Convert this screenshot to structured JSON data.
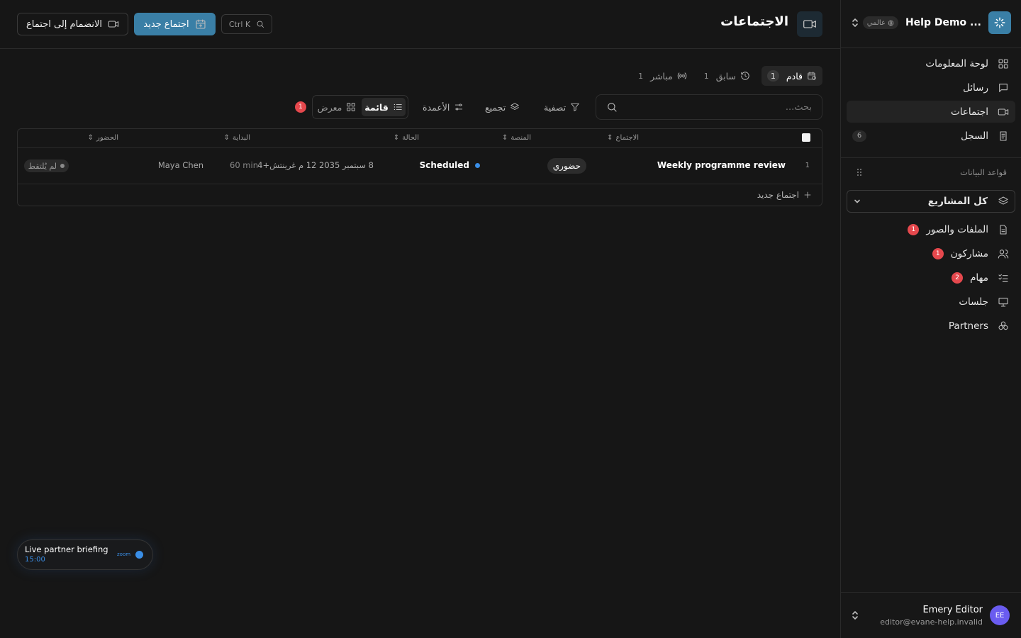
{
  "workspace": {
    "name": "Help Demo ...",
    "badge": "عالمي"
  },
  "sidebar": {
    "nav": [
      {
        "label": "لوحة المعلومات",
        "icon": "dashboard-icon"
      },
      {
        "label": "رسائل",
        "icon": "message-icon"
      },
      {
        "label": "اجتماعات",
        "icon": "video-icon",
        "active": true
      },
      {
        "label": "السجل",
        "icon": "log-icon",
        "count": "6"
      }
    ],
    "section_label": "قواعد البيانات",
    "project_select": "كل المشاريع",
    "db_items": [
      {
        "label": "الملفات والصور",
        "icon": "file-icon",
        "badge": "1"
      },
      {
        "label": "مشاركون",
        "icon": "users-icon",
        "badge": "1"
      },
      {
        "label": "مهام",
        "icon": "tasks-icon",
        "badge": "2"
      },
      {
        "label": "جلسات",
        "icon": "presentation-icon"
      },
      {
        "label": "Partners",
        "icon": "partners-icon"
      }
    ]
  },
  "user": {
    "initials": "EE",
    "name": "Emery Editor",
    "email": "editor@evane-help.invalid"
  },
  "header": {
    "title": "الاجتماعات",
    "new_meeting": "اجتماع جديد",
    "join_meeting": "الانضمام إلى اجتماع",
    "command": "Ctrl K"
  },
  "tabs": [
    {
      "label": "قادم",
      "count": "1",
      "active": true
    },
    {
      "label": "سابق",
      "count": "1"
    },
    {
      "label": "مباشر",
      "count": "1"
    }
  ],
  "toolbar": {
    "search_placeholder": "بحث...",
    "filter": "تصفية",
    "group": "تجميع",
    "columns": "الأعمدة",
    "view_list": "قائمة",
    "view_gallery": "معرض",
    "badge": "1"
  },
  "table": {
    "columns": [
      "الاجتماع",
      "المنصة",
      "الحالة",
      "البداية",
      "الحضور"
    ],
    "rows": [
      {
        "index": "1",
        "meeting": "Weekly programme review",
        "platform": "حضوري",
        "status": "Scheduled",
        "start": "8 سبتمبر 2035 12 م غرينتش+4",
        "duration": "60 min",
        "organizer": "Maya Chen",
        "attendance": "لم يُلتقط"
      }
    ],
    "add_row": "اجتماع جديد"
  },
  "live_card": {
    "title": "Live partner briefing",
    "time": "15:00",
    "platform": "zoom"
  },
  "colors": {
    "accent": "#3a7fa6",
    "badge": "#e5484d",
    "live": "#3a8ee6",
    "background": "#161616"
  }
}
